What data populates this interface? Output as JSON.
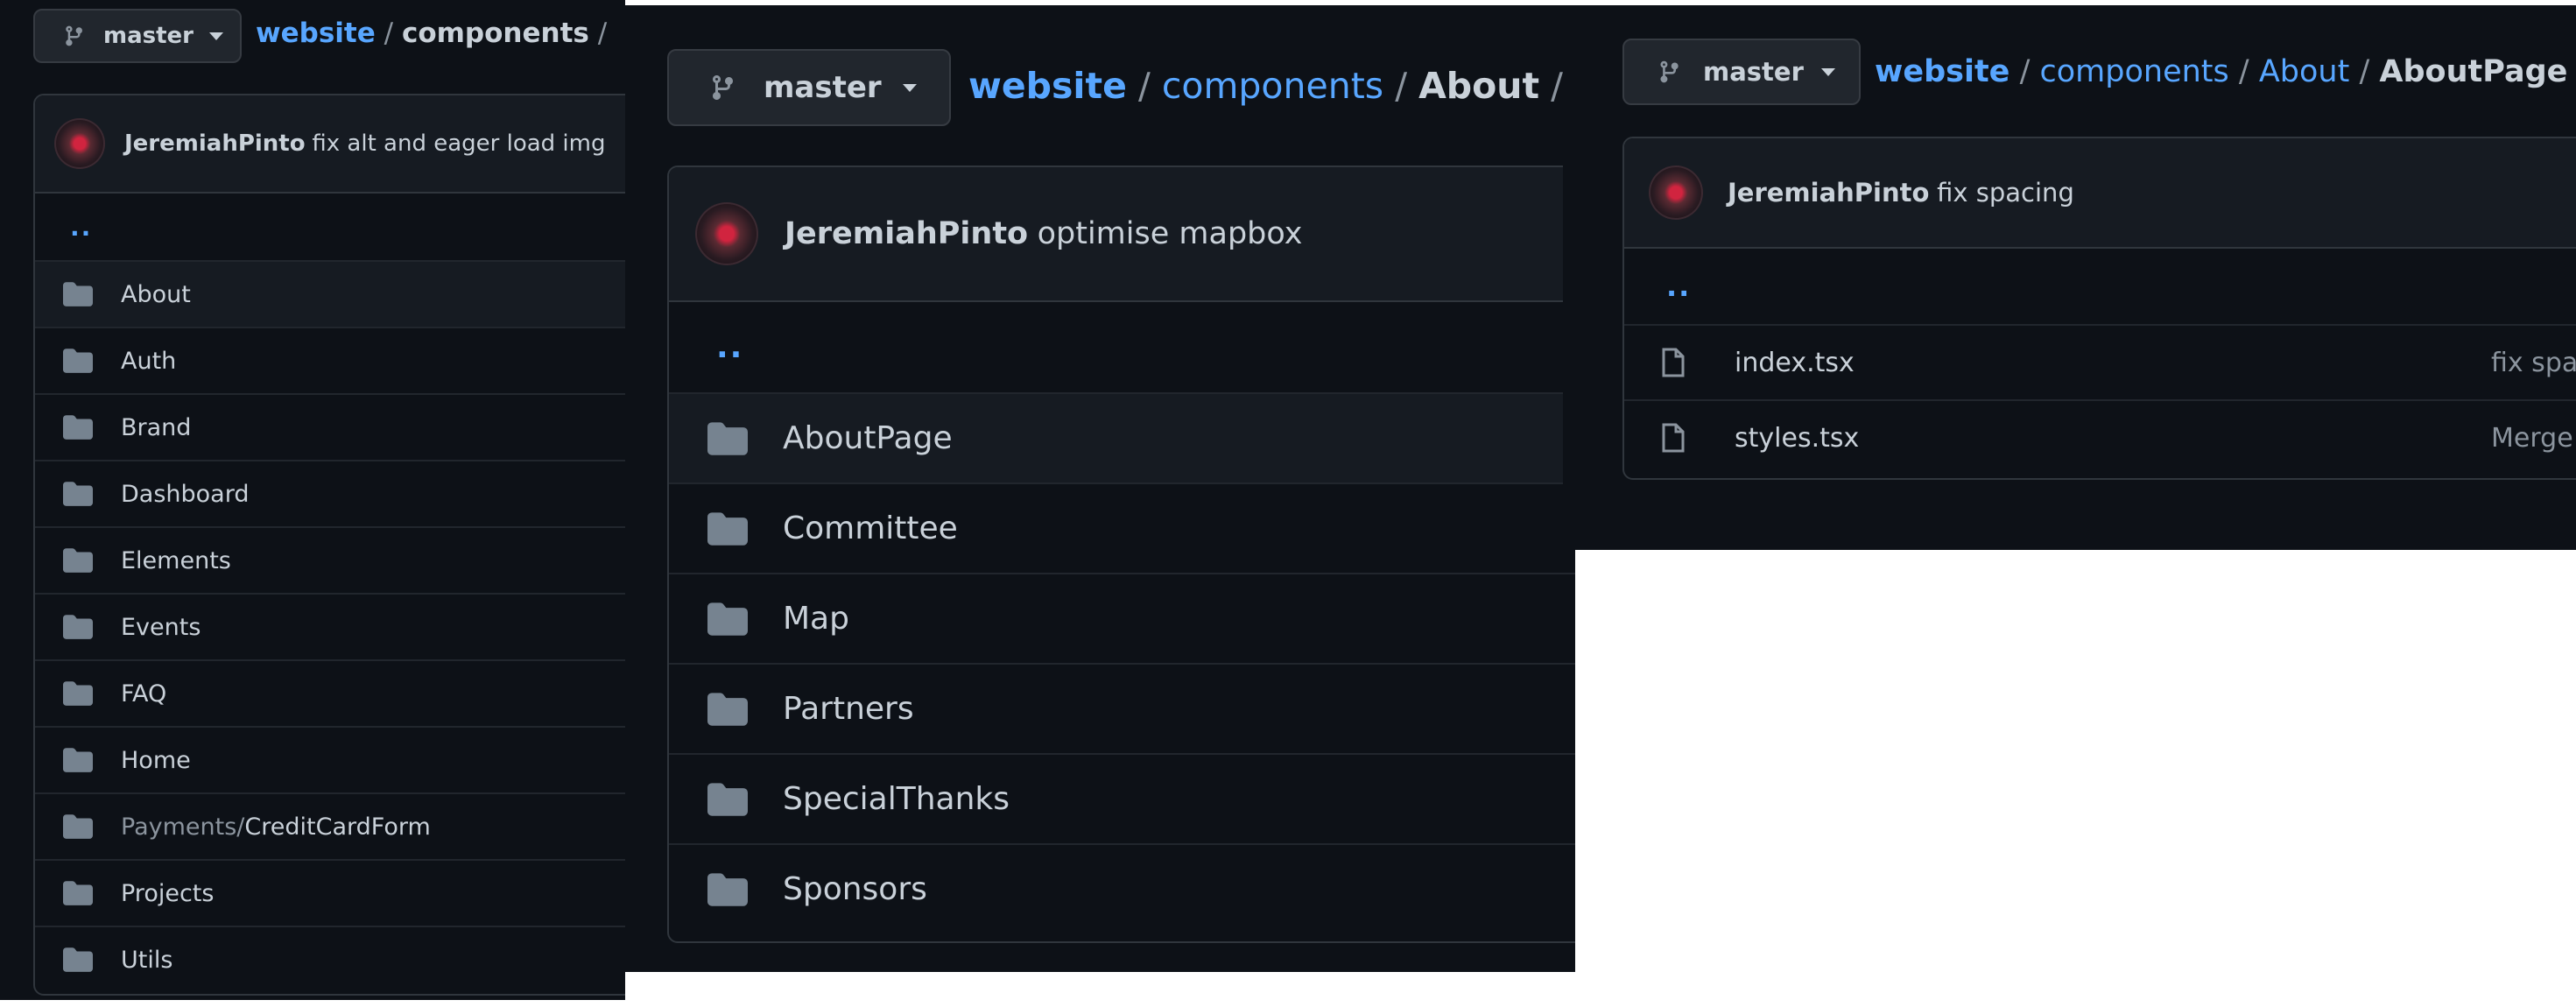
{
  "panels": [
    {
      "branch_label": "master",
      "breadcrumb": {
        "repo": "website",
        "current": "components",
        "sep": "/"
      },
      "commit": {
        "author": "JeremiahPinto",
        "message": "fix alt and eager load img"
      },
      "parent_link": "..",
      "items": [
        {
          "name": "About"
        },
        {
          "name": "Auth"
        },
        {
          "name": "Brand"
        },
        {
          "name": "Dashboard"
        },
        {
          "name": "Elements"
        },
        {
          "name": "Events"
        },
        {
          "name": "FAQ"
        },
        {
          "name": "Home"
        },
        {
          "name_dim": "Payments",
          "name": "CreditCardForm",
          "sep": "/"
        },
        {
          "name": "Projects"
        },
        {
          "name": "Utils"
        }
      ]
    },
    {
      "branch_label": "master",
      "breadcrumb": {
        "repo": "website",
        "mid": "components",
        "current": "About",
        "sep": "/"
      },
      "commit": {
        "author": "JeremiahPinto",
        "message": "optimise mapbox"
      },
      "parent_link": "..",
      "items": [
        {
          "name": "AboutPage"
        },
        {
          "name": "Committee"
        },
        {
          "name": "Map"
        },
        {
          "name": "Partners"
        },
        {
          "name": "SpecialThanks"
        },
        {
          "name": "Sponsors"
        }
      ]
    },
    {
      "branch_label": "master",
      "breadcrumb": {
        "repo": "website",
        "mid1": "components",
        "mid2": "About",
        "current": "AboutPage",
        "sep": "/"
      },
      "commit": {
        "author": "JeremiahPinto",
        "message": "fix spacing"
      },
      "parent_link": "..",
      "files": [
        {
          "name": "index.tsx",
          "commit_msg": "fix spa"
        },
        {
          "name": "styles.tsx",
          "commit_msg": "Merge"
        }
      ]
    }
  ],
  "colors": {
    "bg": "#0d1117",
    "link": "#58a6ff",
    "text": "#c9d1d9",
    "muted": "#8b949e",
    "border": "#30363d",
    "folder_icon": "#768390"
  }
}
